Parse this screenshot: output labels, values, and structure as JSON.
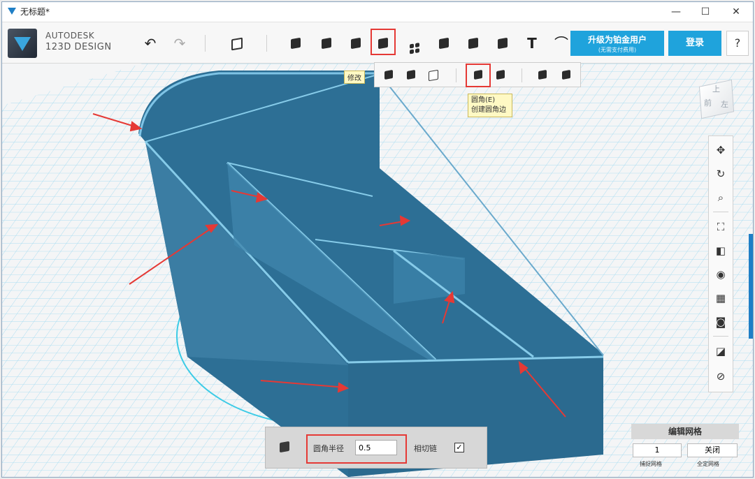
{
  "titlebar": {
    "title": "无标题*",
    "minimize": "—",
    "maximize": "☐",
    "close": "✕"
  },
  "brand": {
    "line1": "AUTODESK",
    "line2": "123D DESIGN"
  },
  "toolbar": {
    "undo": "↶",
    "redo": "↷",
    "text_tool": "T",
    "upgrade_label": "升级为铂金用户",
    "upgrade_sub": "(无需支付费用)",
    "login_label": "登录",
    "help_label": "?"
  },
  "tooltips": {
    "modify": "修改",
    "fillet_title": "圆角(E)",
    "fillet_desc": "创建圆角边"
  },
  "viewcube": {
    "top": "上",
    "left": "左",
    "front": "前"
  },
  "fillet_panel": {
    "radius_label": "圆角半径",
    "radius_value": "0.5",
    "tangent_label": "相切链",
    "tangent_checked": "✓"
  },
  "grid_panel": {
    "title": "编辑网格",
    "snap_value": "1",
    "toggle_label": "关闭",
    "snap_caption": "捕捉网格",
    "toggle_caption": "全定网格"
  },
  "colors": {
    "model": "#2b6a8f",
    "accent": "#1fa3dc",
    "highlight": "#e53935",
    "grid": "#8fd3ee"
  }
}
